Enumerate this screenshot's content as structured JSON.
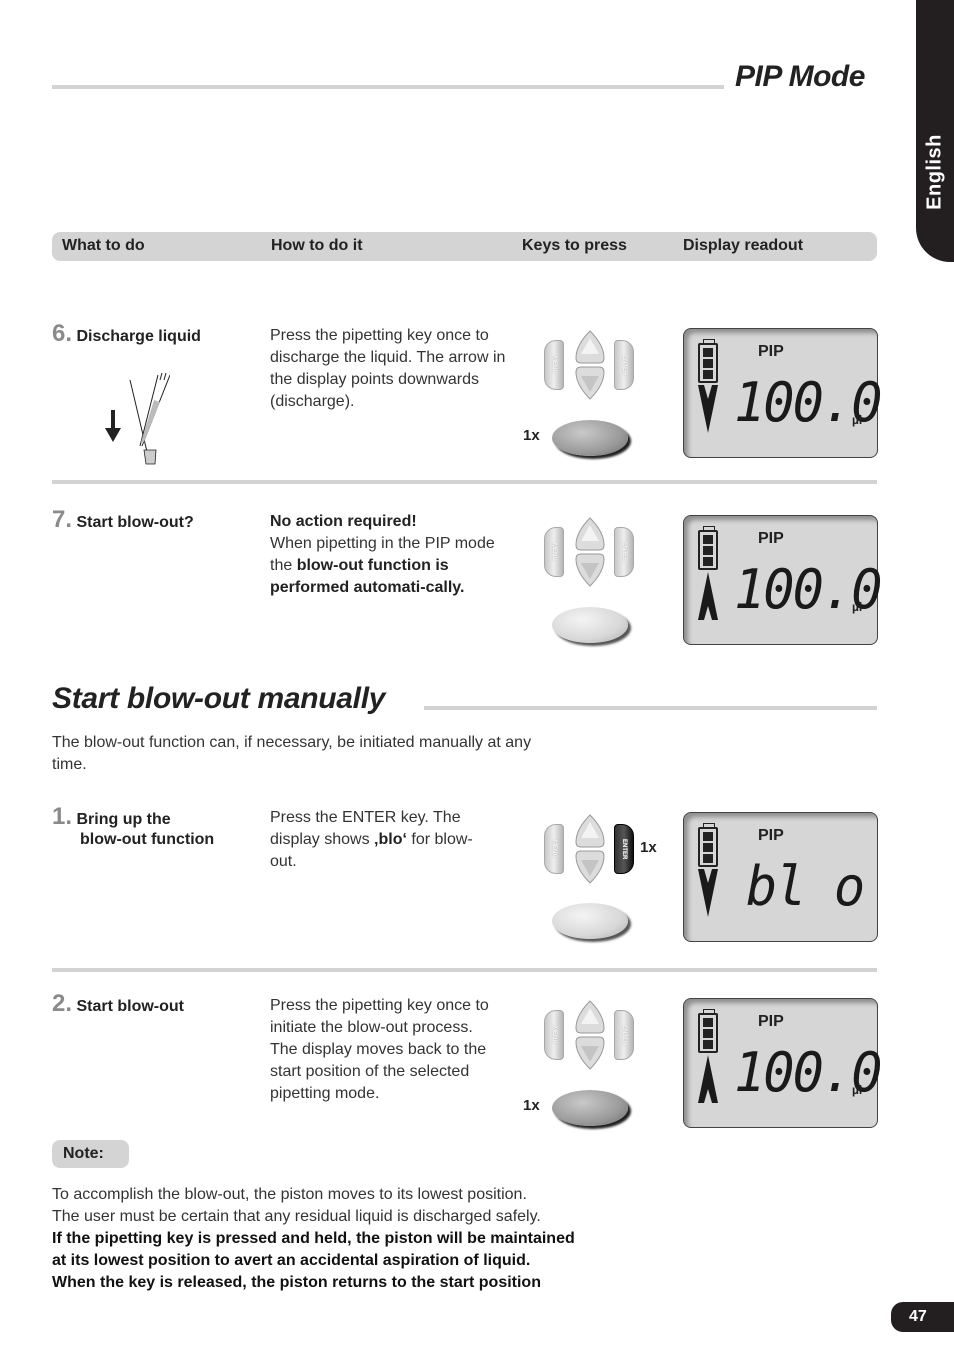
{
  "header": {
    "title": "PIP Mode"
  },
  "language_tab": "English",
  "columns": [
    "What to do",
    "How to do it",
    "Keys to press",
    "Display readout"
  ],
  "steps_pip": [
    {
      "number": "6.",
      "title": "Discharge liquid",
      "description": "Press the pipetting key once to discharge the liquid. The arrow in the display points downwards (discharge).",
      "illustration": "pipette-discharge-icon",
      "keys": {
        "trigger_pressed": true,
        "trigger_count": "1x",
        "enter_pressed": false,
        "enter_count": ""
      },
      "display": {
        "mode": "PIP",
        "arrow": "down",
        "value": "100.0",
        "unit": "µl",
        "battery_bars": 3
      }
    },
    {
      "number": "7.",
      "title": "Start blow-out?",
      "description_bold_lead": "No action required!",
      "description_parts": [
        {
          "text": "When pipetting in the PIP mode the ",
          "bold": false
        },
        {
          "text": "blow-out function is performed automati-cally.",
          "bold": true
        }
      ],
      "keys": {
        "trigger_pressed": false,
        "trigger_count": "",
        "enter_pressed": false,
        "enter_count": ""
      },
      "display": {
        "mode": "PIP",
        "arrow": "up",
        "value": "100.0",
        "unit": "µl",
        "battery_bars": 3
      }
    }
  ],
  "section": {
    "title": "Start blow-out manually",
    "intro": "The blow-out function can, if necessary, be initiated manually at any time."
  },
  "steps_manual": [
    {
      "number": "1.",
      "title_lines": [
        "Bring up the",
        "blow-out function"
      ],
      "description_parts": [
        {
          "text": "Press the ENTER key. The display shows ",
          "bold": false
        },
        {
          "text": "‚blo‘",
          "bold": true
        },
        {
          "text": " for blow-out.",
          "bold": false
        }
      ],
      "keys": {
        "trigger_pressed": false,
        "trigger_count": "",
        "enter_pressed": true,
        "enter_count": "1x"
      },
      "display": {
        "mode": "PIP",
        "arrow": "down",
        "value": "bl o",
        "unit": "",
        "battery_bars": 3
      }
    },
    {
      "number": "2.",
      "title": "Start blow-out",
      "description": "Press the pipetting key once to initiate the blow-out process. The display moves back to the start position of the selected pipetting mode.",
      "keys": {
        "trigger_pressed": true,
        "trigger_count": "1x",
        "enter_pressed": false,
        "enter_count": ""
      },
      "display": {
        "mode": "PIP",
        "arrow": "up",
        "value": "100.0",
        "unit": "µl",
        "battery_bars": 3
      }
    }
  ],
  "key_labels": {
    "menu": "MENU",
    "enter": "ENTER"
  },
  "note": {
    "label": "Note:",
    "lines": [
      {
        "text": "To accomplish the blow-out, the piston moves to its lowest position.",
        "bold": false
      },
      {
        "text": "The user must be certain that any residual liquid is discharged safely.",
        "bold": false
      },
      {
        "text": "If the pipetting key is pressed and held, the piston will be maintained",
        "bold": true
      },
      {
        "text": "at its lowest position to avert an accidental aspiration of liquid.",
        "bold": true
      },
      {
        "text": "When the key is released, the piston returns to the start position",
        "bold": true
      }
    ]
  },
  "page_number": "47"
}
